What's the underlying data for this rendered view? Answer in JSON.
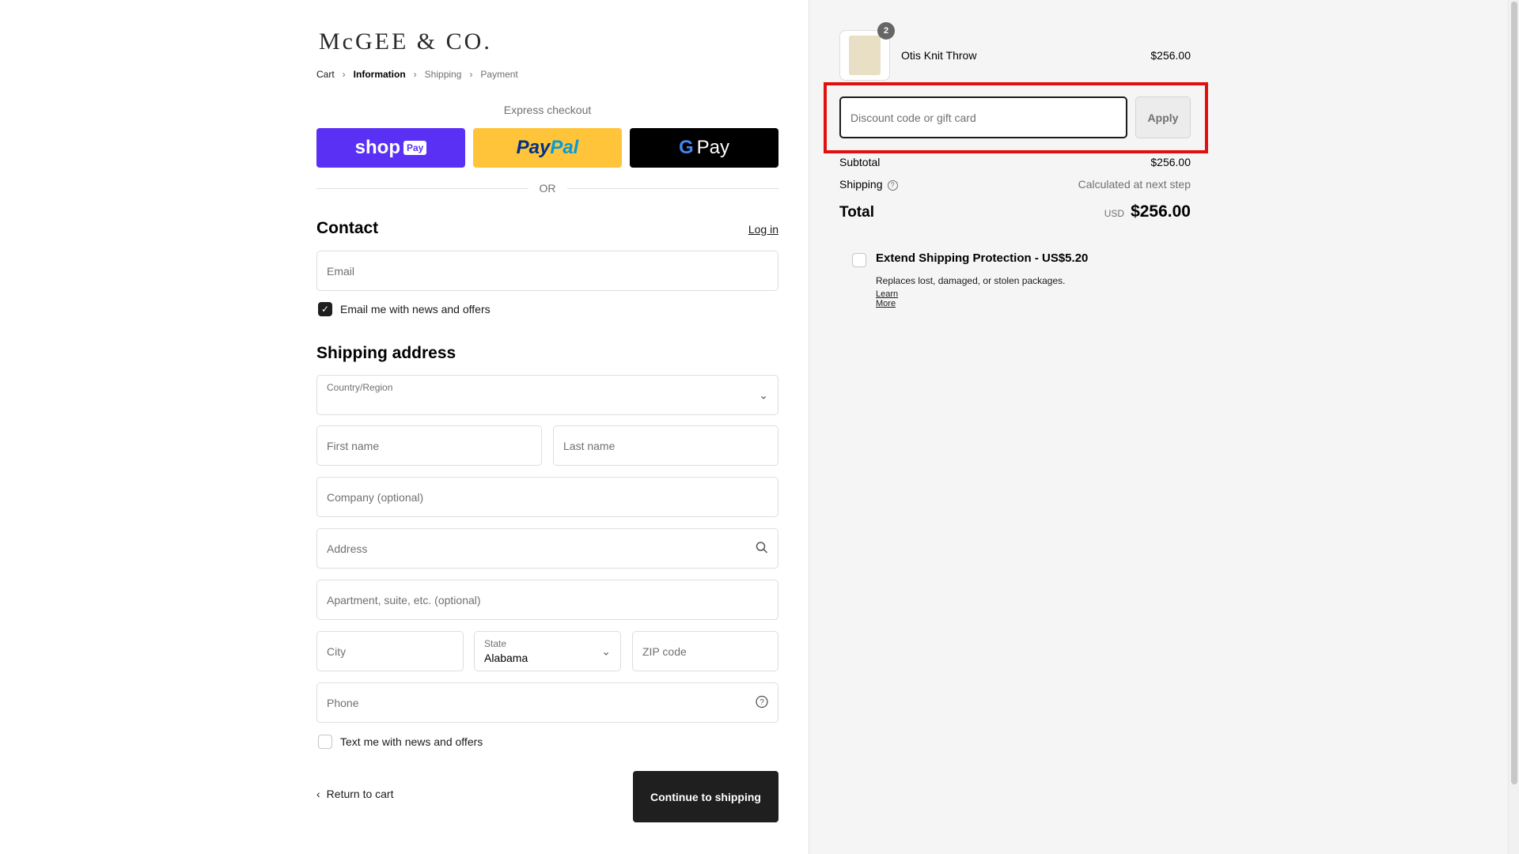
{
  "brand": {
    "logo": "McGEE & CO."
  },
  "breadcrumb": {
    "cart": "Cart",
    "information": "Information",
    "shipping": "Shipping",
    "payment": "Payment"
  },
  "express": {
    "label": "Express checkout",
    "shop_pay": "shop",
    "shop_pay_badge": "Pay",
    "paypal_1": "Pay",
    "paypal_2": "Pal",
    "gpay_g": "G",
    "gpay": "Pay",
    "or": "OR"
  },
  "contact": {
    "heading": "Contact",
    "login": "Log in",
    "email_placeholder": "Email",
    "news_label": "Email me with news and offers",
    "news_checked": true
  },
  "shipping": {
    "heading": "Shipping address",
    "country_label": "Country/Region",
    "country_value": "",
    "first_name": "First name",
    "last_name": "Last name",
    "company": "Company (optional)",
    "address": "Address",
    "apartment": "Apartment, suite, etc. (optional)",
    "city": "City",
    "state_label": "State",
    "state_value": "Alabama",
    "zip": "ZIP code",
    "phone": "Phone",
    "text_label": "Text me with news and offers",
    "text_checked": false
  },
  "actions": {
    "return": "Return to cart",
    "continue": "Continue to shipping"
  },
  "order": {
    "item_name": "Otis Knit Throw",
    "item_price": "$256.00",
    "item_qty": "2",
    "discount_placeholder": "Discount code or gift card",
    "apply": "Apply",
    "subtotal_label": "Subtotal",
    "subtotal_value": "$256.00",
    "shipping_label": "Shipping",
    "shipping_value": "Calculated at next step",
    "total_label": "Total",
    "currency": "USD",
    "total_value": "$256.00"
  },
  "extend": {
    "title": "Extend Shipping Protection - US$5.20",
    "subtitle": "Replaces lost, damaged, or stolen packages.",
    "learn": "Learn More"
  },
  "colors": {
    "highlight": "#e01010",
    "shop_pay": "#5a31f4",
    "paypal": "#ffc439",
    "primary_button": "#1f1f1f"
  }
}
